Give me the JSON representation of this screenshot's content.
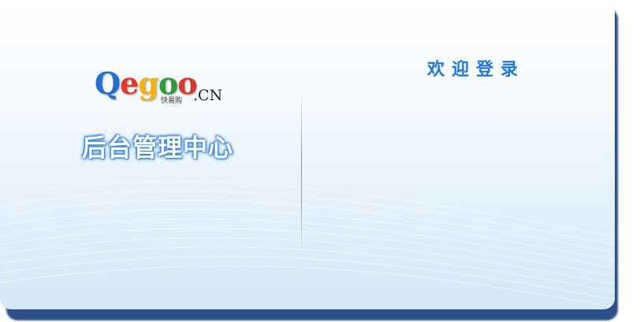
{
  "logo": {
    "wordmark_letters": [
      "Q",
      "e",
      "g",
      "o",
      "o"
    ],
    "subtitle": "快易购",
    "domain": ".CN"
  },
  "panel": {
    "title": "后台管理中心",
    "welcome": "欢迎登录"
  },
  "colors": {
    "accent": "#1f78d6",
    "card_shadow": "#2c4f86",
    "logo_blue": "#1f6fd0",
    "logo_red": "#e03a2a",
    "logo_yellow": "#f2b316",
    "logo_green": "#2f9a3c"
  }
}
